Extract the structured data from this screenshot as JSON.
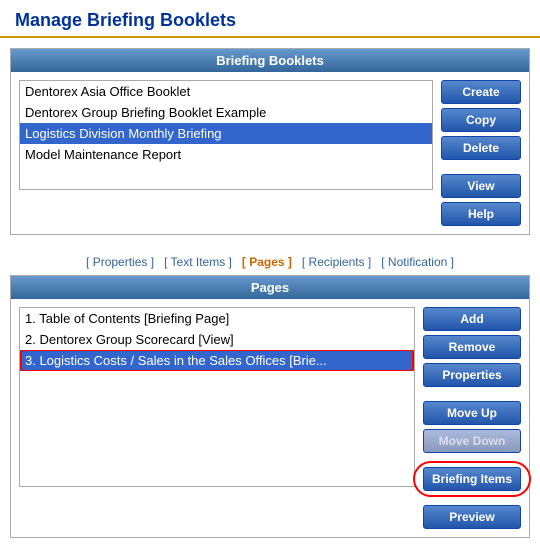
{
  "page": {
    "title": "Manage Briefing Booklets"
  },
  "booklets_section": {
    "header": "Briefing Booklets",
    "items": [
      {
        "label": "Dentorex Asia Office Booklet",
        "selected": false
      },
      {
        "label": "Dentorex Group Briefing Booklet Example",
        "selected": false
      },
      {
        "label": "Logistics Division Monthly Briefing",
        "selected": true
      },
      {
        "label": "Model Maintenance Report",
        "selected": false
      }
    ],
    "buttons": {
      "create": "Create",
      "copy": "Copy",
      "delete": "Delete",
      "view": "View",
      "help": "Help"
    }
  },
  "tabs": [
    {
      "label": "[ Properties ]",
      "active": false
    },
    {
      "label": "[ Text Items ]",
      "active": false
    },
    {
      "label": "[ Pages ]",
      "active": true
    },
    {
      "label": "[ Recipients ]",
      "active": false
    },
    {
      "label": "[ Notification ]",
      "active": false
    }
  ],
  "pages_section": {
    "header": "Pages",
    "items": [
      {
        "label": "1. Table of Contents [Briefing Page]",
        "selected": false
      },
      {
        "label": "2. Dentorex Group Scorecard [View]",
        "selected": false
      },
      {
        "label": "3. Logistics Costs / Sales in the Sales Offices [Brie...",
        "selected": true,
        "circled": true
      }
    ],
    "buttons": {
      "add": "Add",
      "remove": "Remove",
      "properties": "Properties",
      "move_up": "Move Up",
      "move_down": "Move Down",
      "briefing_items": "Briefing Items",
      "preview": "Preview"
    }
  }
}
